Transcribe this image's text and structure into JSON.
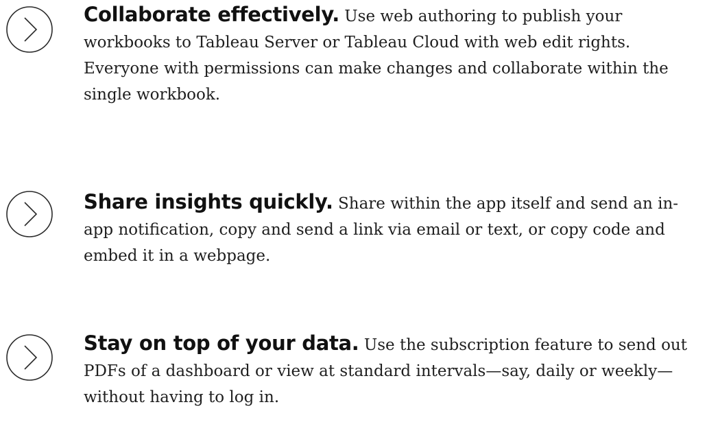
{
  "items": [
    {
      "icon": "chevron-right-circle-icon",
      "heading": "Collaborate effectively.",
      "body": "Use web authoring to publish your workbooks to Tableau Server or Tableau Cloud with web edit rights. Everyone with permissions can make changes and collaborate within the single workbook."
    },
    {
      "icon": "chevron-right-circle-icon",
      "heading": "Share insights quickly.",
      "body": "Share within the app itself and send an in-app notification, copy and send a link via email or text, or copy code and embed it in a webpage."
    },
    {
      "icon": "chevron-right-circle-icon",
      "heading": "Stay on top of your data.",
      "body": "Use the subscription feature to send out PDFs of a dashboard or view at standard intervals—say, daily or weekly—without having to log in."
    }
  ],
  "colors": {
    "text": "#1f1f1f",
    "icon_stroke": "#2a2a2a"
  }
}
